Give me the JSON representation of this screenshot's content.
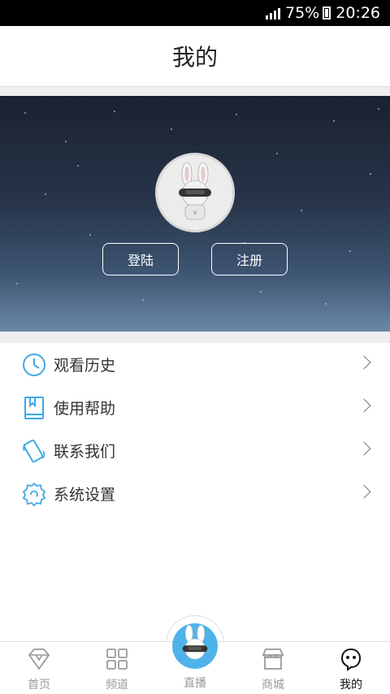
{
  "status_bar": {
    "battery": "75%",
    "time": "20:26"
  },
  "header": {
    "title": "我的"
  },
  "hero": {
    "login_label": "登陆",
    "register_label": "注册"
  },
  "menu": [
    {
      "label": "观看历史",
      "icon": "clock-icon"
    },
    {
      "label": "使用帮助",
      "icon": "book-icon"
    },
    {
      "label": "联系我们",
      "icon": "phone-icon"
    },
    {
      "label": "系统设置",
      "icon": "settings-icon"
    }
  ],
  "tabs": [
    {
      "label": "首页",
      "icon": "diamond-icon"
    },
    {
      "label": "频道",
      "icon": "grid-icon"
    },
    {
      "label": "直播",
      "icon": "mascot-icon"
    },
    {
      "label": "商城",
      "icon": "shop-icon"
    },
    {
      "label": "我的",
      "icon": "face-icon",
      "active": true
    }
  ],
  "colors": {
    "accent": "#4fb3ea",
    "icon_blue": "#3fa9e6"
  }
}
